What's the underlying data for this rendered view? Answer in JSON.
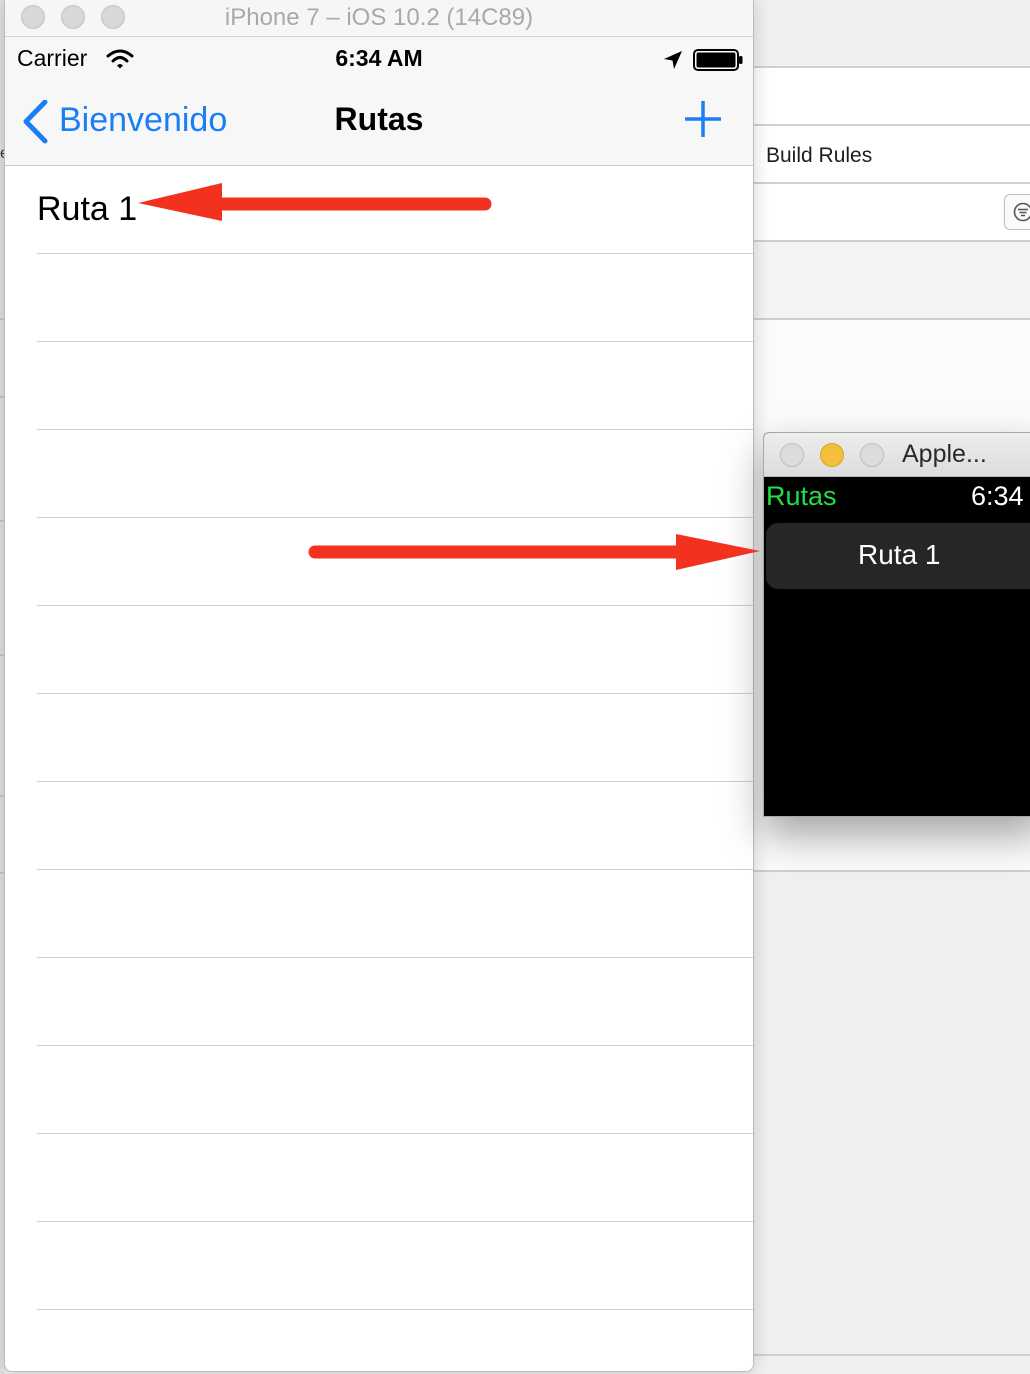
{
  "colors": {
    "ios_tint": "#1a7ff5",
    "watch_accent": "#22dd44",
    "arrow": "#f2311f",
    "minimize_yellow": "#f5be3c"
  },
  "background_app": {
    "tab_label": "Build Rules",
    "filter_icon": "filter-icon"
  },
  "simulator": {
    "window_title": "iPhone 7 – iOS 10.2 (14C89)",
    "status_bar": {
      "carrier": "Carrier",
      "time": "6:34 AM",
      "icons": [
        "wifi-icon",
        "location-arrow-icon",
        "battery-icon"
      ]
    },
    "nav": {
      "back_label": "Bienvenido",
      "title": "Rutas",
      "add_icon": "plus-icon"
    },
    "rows": [
      "Ruta 1",
      "",
      "",
      "",
      "",
      "",
      "",
      "",
      "",
      "",
      "",
      "",
      "",
      ""
    ]
  },
  "watch": {
    "window_title": "Apple...",
    "header_title": "Rutas",
    "time": "6:34",
    "rows": [
      "Ruta 1"
    ]
  }
}
